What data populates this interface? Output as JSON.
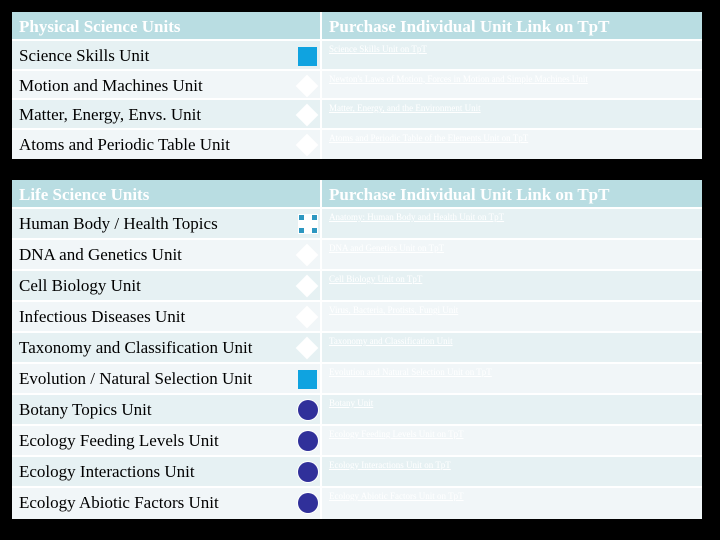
{
  "physical": {
    "header_left": "Physical Science Units",
    "header_right": "Purchase Individual Unit Link on TpT",
    "rows": [
      {
        "label": "Science Skills Unit",
        "icon": "square",
        "link": "Science Skills Unit on TpT"
      },
      {
        "label": "Motion and Machines Unit",
        "icon": "diamond",
        "link": "Newton's Laws of Motion, Forces in Motion and Simple Machines Unit"
      },
      {
        "label": "Matter, Energy, Envs. Unit",
        "icon": "diamond",
        "link": "Matter, Energy, and the Environment Unit"
      },
      {
        "label": "Atoms and Periodic Table Unit",
        "icon": "diamond",
        "link": "Atoms and Periodic Table of the Elements Unit on TpT"
      }
    ]
  },
  "life": {
    "header_left": "Life Science Units",
    "header_right": "Purchase Individual Unit Link on TpT",
    "rows": [
      {
        "label": "Human Body / Health Topics",
        "icon": "frame",
        "link": "Anatomy: Human Body and Health Unit on TpT"
      },
      {
        "label": "DNA and Genetics Unit",
        "icon": "diamond",
        "link": "DNA and Genetics Unit on TpT"
      },
      {
        "label": "Cell Biology Unit",
        "icon": "diamond",
        "link": "Cell Biology Unit on TpT"
      },
      {
        "label": "Infectious Diseases Unit",
        "icon": "diamond",
        "link": "Virus, Bacteria, Protists, Fungi Unit"
      },
      {
        "label": "Taxonomy and Classification Unit",
        "icon": "diamond",
        "link": "Taxonomy and Classification Unit"
      },
      {
        "label": "Evolution / Natural Selection Unit",
        "icon": "square",
        "link": "Evolution and Natural Selection Unit on TpT"
      },
      {
        "label": "Botany Topics Unit",
        "icon": "circle",
        "link": "Botany Unit"
      },
      {
        "label": "Ecology Feeding Levels Unit",
        "icon": "circle",
        "link": "Ecology Feeding Levels Unit on TpT"
      },
      {
        "label": "Ecology Interactions Unit",
        "icon": "circle",
        "link": "Ecology Interactions Unit on TpT"
      },
      {
        "label": "Ecology Abiotic Factors Unit",
        "icon": "circle",
        "link": "Ecology Abiotic Factors Unit on TpT"
      }
    ]
  },
  "colors": {
    "header_bg": "#b9dde2",
    "row_odd": "#e6f1f3",
    "row_even": "#f1f6f8",
    "square_icon": "#0fa3e0",
    "circle_icon": "#30309a",
    "frame_icon": "#2c97c1"
  }
}
